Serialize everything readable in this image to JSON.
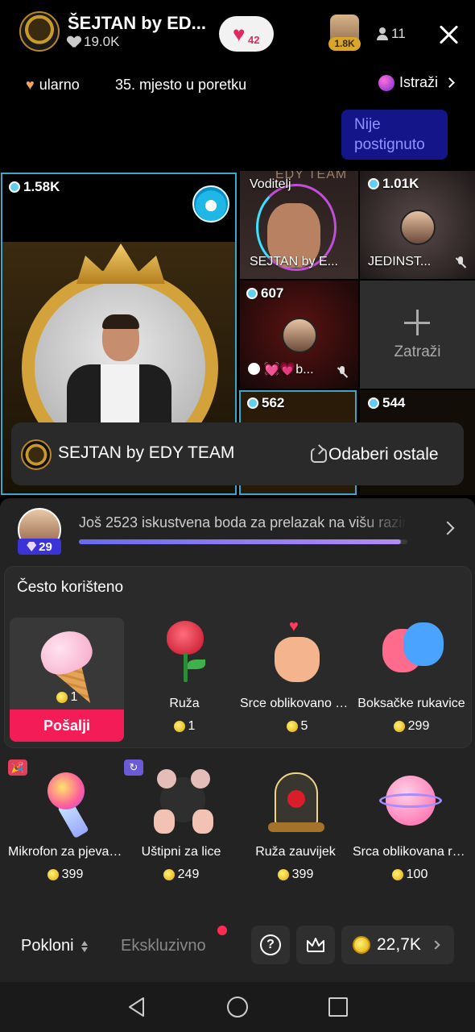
{
  "header": {
    "host_name": "ŠEJTAN by ED...",
    "host_likes": "19.0K",
    "hearts_count": "42",
    "top_viewer_badge": "1.8K",
    "viewer_count": "11",
    "info_left": "ularno",
    "rank_text": "35. mjesto u poretku",
    "explore_label": "Istraži",
    "goal_text": "Nije postignuto"
  },
  "grid": {
    "main_score": "1.58K",
    "host_tile_label": "Voditelj",
    "host_tile_name": "SEJTAN by E...",
    "host_tile_watermark": "EDY TEAM",
    "tile_b_score": "1.01K",
    "tile_b_name": "JEDINST...",
    "tile_c_score": "607",
    "tile_c_name": "b...",
    "tile_d_label": "Zatraži",
    "tile_e_score": "562",
    "tile_f_score": "544"
  },
  "select_bar": {
    "name": "SEJTAN by EDY TEAM",
    "switch_label": "Odaberi ostale"
  },
  "panel": {
    "level": "29",
    "xp_text": "Još 2523 iskustvena boda za prelazak na višu razinu",
    "xp_progress": 0.98,
    "frequent_title": "Često korišteno",
    "frequent_gifts": [
      {
        "name": "",
        "price": "1",
        "icon": "ice-cream-icon"
      },
      {
        "name": "Ruža",
        "price": "1",
        "icon": "rose-icon"
      },
      {
        "name": "Srce oblikovano prstima",
        "price": "5",
        "icon": "finger-heart-icon"
      },
      {
        "name": "Boksačke rukavice",
        "price": "299",
        "icon": "boxing-gloves-icon"
      }
    ],
    "send_label": "Pošalji",
    "gifts": [
      {
        "name": "Mikrofon za pjevanje",
        "price": "399",
        "icon": "microphone-icon"
      },
      {
        "name": "Uštipni za lice",
        "price": "249",
        "icon": "pinch-face-icon"
      },
      {
        "name": "Ruža zauvijek",
        "price": "399",
        "icon": "rose-jar-icon"
      },
      {
        "name": "Srca oblikovana rukama",
        "price": "100",
        "icon": "heart-globe-icon"
      }
    ]
  },
  "bottom": {
    "tab_gifts": "Pokloni",
    "tab_exclusive": "Ekskluzivno",
    "help_symbol": "?",
    "coins": "22,7K"
  },
  "colors": {
    "accent_send": "#f41c56",
    "selection_border": "#3aa6c8",
    "level_badge": "#3b32d8"
  }
}
